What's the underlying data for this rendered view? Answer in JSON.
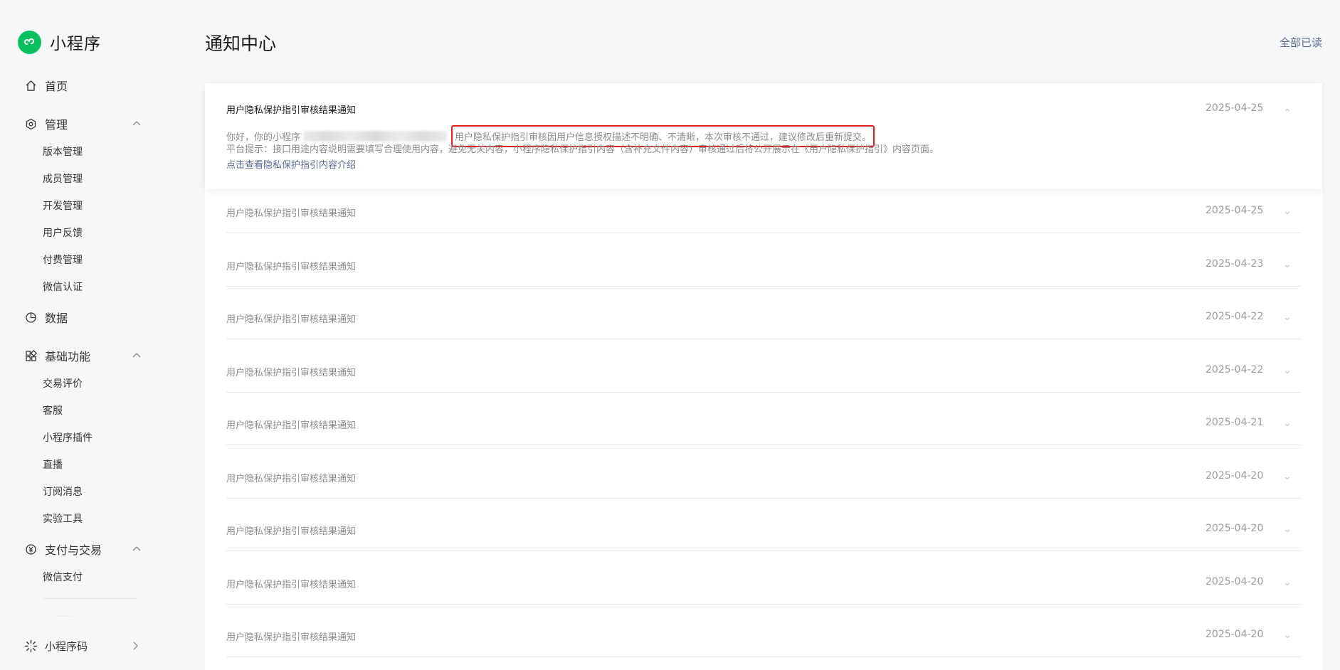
{
  "brand": {
    "name": "小程序"
  },
  "page_title": "通知中心",
  "mark_all_read": "全部已读",
  "sidebar": {
    "home": "首页",
    "manage": {
      "label": "管理",
      "items": [
        "版本管理",
        "成员管理",
        "开发管理",
        "用户反馈",
        "付费管理",
        "微信认证"
      ]
    },
    "data": "数据",
    "basic": {
      "label": "基础功能",
      "items": [
        "交易评价",
        "客服",
        "小程序插件",
        "直播",
        "订阅消息",
        "实验工具"
      ]
    },
    "pay": {
      "label": "支付与交易",
      "items": [
        "微信支付"
      ]
    },
    "qr": "小程序码"
  },
  "expanded": {
    "title": "用户隐私保护指引审核结果通知",
    "date": "2025-04-25",
    "greeting": "你好，你的小程序",
    "highlight": "用户隐私保护指引审核因用户信息授权描述不明确、不清晰，本次审核不通过，建议修改后重新提交。",
    "tip": "平台提示：接口用途内容说明需要填写合理使用内容，避免无关内容，小程序隐私保护指引内容（含补充文件内容）审核通过后将公开展示在《用户隐私保护指引》内容页面。",
    "link": "点击查看隐私保护指引内容介绍"
  },
  "notifications": [
    {
      "title": "用户隐私保护指引审核结果通知",
      "date": "2025-04-25"
    },
    {
      "title": "用户隐私保护指引审核结果通知",
      "date": "2025-04-23"
    },
    {
      "title": "用户隐私保护指引审核结果通知",
      "date": "2025-04-22"
    },
    {
      "title": "用户隐私保护指引审核结果通知",
      "date": "2025-04-22"
    },
    {
      "title": "用户隐私保护指引审核结果通知",
      "date": "2025-04-21"
    },
    {
      "title": "用户隐私保护指引审核结果通知",
      "date": "2025-04-20"
    },
    {
      "title": "用户隐私保护指引审核结果通知",
      "date": "2025-04-20"
    },
    {
      "title": "用户隐私保护指引审核结果通知",
      "date": "2025-04-20"
    },
    {
      "title": "用户隐私保护指引审核结果通知",
      "date": "2025-04-20"
    }
  ],
  "colors": {
    "brand": "#07c160",
    "link": "#576b95",
    "highlight_border": "#e02020"
  }
}
